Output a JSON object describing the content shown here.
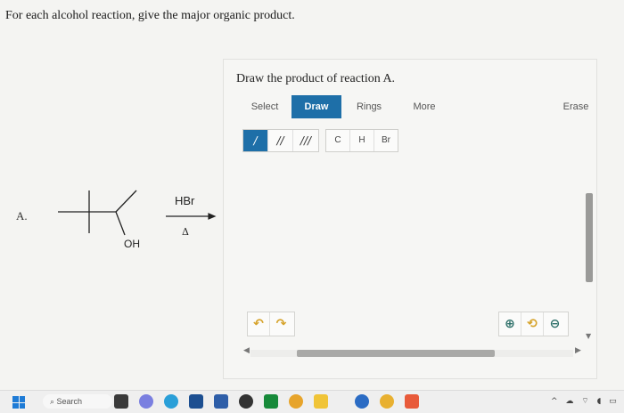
{
  "question": "For each alcohol reaction, give the major organic product.",
  "reaction": {
    "label": "A.",
    "reagent": "HBr",
    "condition": "Δ",
    "substituent": "OH"
  },
  "editor": {
    "title": "Draw the product of reaction A.",
    "toolbar": {
      "select": "Select",
      "draw": "Draw",
      "rings": "Rings",
      "more": "More",
      "erase": "Erase"
    },
    "bonds": [
      "/",
      "//",
      "///"
    ],
    "atoms": [
      "C",
      "H",
      "Br"
    ],
    "undo_icon": "undo-icon",
    "redo_icon": "redo-icon",
    "zoom_in_icon": "zoom-in-icon",
    "reset_icon": "reset-icon",
    "zoom_out_icon": "zoom-out-icon",
    "accent_color": "#1e6fa8"
  },
  "taskbar": {
    "search_label": "Search"
  }
}
